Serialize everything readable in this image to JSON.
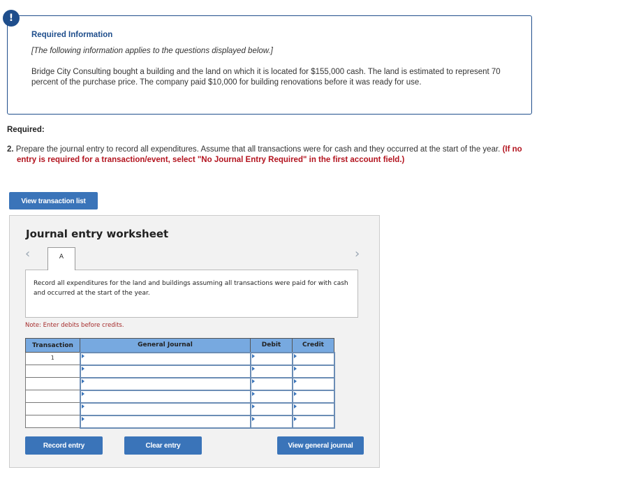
{
  "info": {
    "icon": "exclamation-icon",
    "title": "Required Information",
    "subtitle": "[The following information applies to the questions displayed below.]",
    "text": "Bridge City Consulting bought a building and the land on which it is located for $155,000 cash. The land is estimated to represent 70 percent of the purchase price. The company paid $10,000 for building renovations before it was ready for use."
  },
  "required": {
    "label": "Required:",
    "question_number": "2.",
    "question_text": " Prepare the journal entry to record all expenditures. Assume that all transactions were for cash and they occurred at the start of the year. ",
    "instruction": "(If no entry is required for a transaction/event, select \"No Journal Entry Required\" in the first account field.)"
  },
  "buttons": {
    "view_transaction_list": "View transaction list",
    "record_entry": "Record entry",
    "clear_entry": "Clear entry",
    "view_general_journal": "View general journal"
  },
  "worksheet": {
    "title": "Journal entry worksheet",
    "prev_icon": "‹",
    "next_icon": "›",
    "tabs": [
      {
        "label": "A"
      }
    ],
    "description": "Record all expenditures for the land and buildings assuming all transactions were paid for with cash and occurred at the start of the year.",
    "note": "Note: Enter debits before credits.",
    "table": {
      "headers": [
        "Transaction",
        "General Journal",
        "Debit",
        "Credit"
      ],
      "rows": [
        {
          "transaction": "1",
          "account": "",
          "debit": "",
          "credit": ""
        },
        {
          "transaction": "",
          "account": "",
          "debit": "",
          "credit": ""
        },
        {
          "transaction": "",
          "account": "",
          "debit": "",
          "credit": ""
        },
        {
          "transaction": "",
          "account": "",
          "debit": "",
          "credit": ""
        },
        {
          "transaction": "",
          "account": "",
          "debit": "",
          "credit": ""
        },
        {
          "transaction": "",
          "account": "",
          "debit": "",
          "credit": ""
        }
      ]
    }
  },
  "colors": {
    "accent": "#1f4e8c",
    "button": "#3a74b9",
    "warning_red": "#b3141f",
    "table_header": "#77a9e0"
  }
}
